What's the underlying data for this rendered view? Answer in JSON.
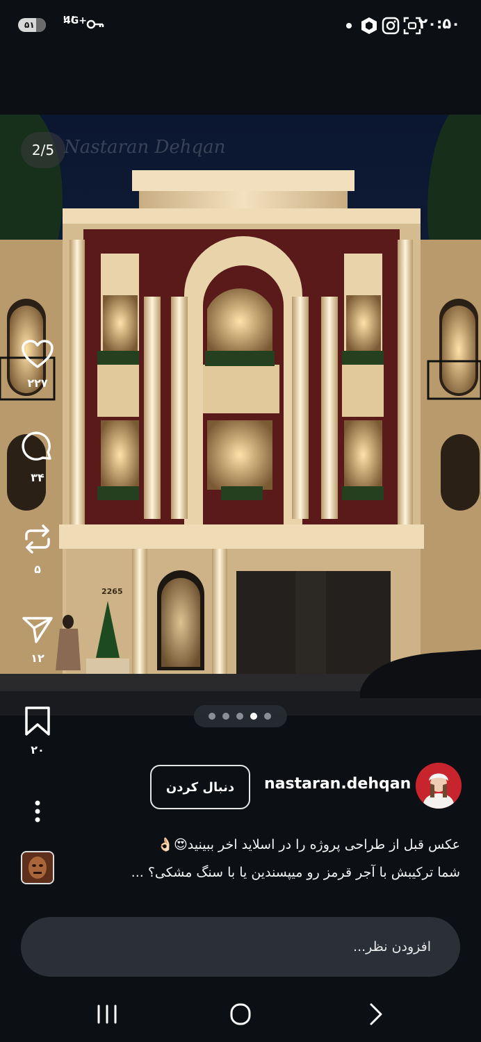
{
  "status_bar": {
    "battery": "۵۱",
    "network": "4G+",
    "signal": "!!!",
    "time": "۲۰:۵۰",
    "icons": [
      "key-icon",
      "dot-icon",
      "hexagon-app-icon",
      "instagram-icon",
      "screenshot-icon"
    ]
  },
  "post": {
    "image_counter": "2/5",
    "watermark": "Nastaran Dehqan",
    "house_number": "2265",
    "slide_count": 5,
    "active_slide": 4
  },
  "actions": {
    "likes": "۲۲۷",
    "comments": "۳۴",
    "reposts": "۵",
    "shares": "۱۲",
    "saves": "۲۰"
  },
  "author": {
    "username": "nastaran.dehqan",
    "follow_label": "دنبال کردن"
  },
  "caption": {
    "line1": "عکس قبل از طراحی پروژه را در اسلاید اخر ببینید😍👌🏻",
    "line2": "شما ترکیبش با آجر قرمز رو میپسندین یا با سنگ مشکی؟ ..."
  },
  "comment": {
    "placeholder": "افزودن نظر..."
  },
  "colors": {
    "background": "#0c1015",
    "input_background": "#2b3038",
    "brick": "#5a1a1a",
    "stone": "#e6d2ae",
    "sky": "#101d36"
  }
}
